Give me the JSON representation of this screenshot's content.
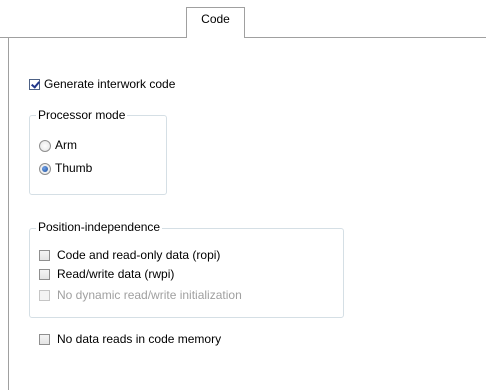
{
  "tabs": [
    {
      "label": "Code",
      "active": true
    }
  ],
  "generate_interwork": {
    "label": "Generate interwork code",
    "checked": true
  },
  "processor_mode": {
    "title": "Processor mode",
    "options": [
      {
        "label": "Arm",
        "selected": false
      },
      {
        "label": "Thumb",
        "selected": true
      }
    ]
  },
  "position_independence": {
    "title": "Position-independence",
    "options": [
      {
        "label": "Code and read-only data (ropi)",
        "checked": false,
        "enabled": true
      },
      {
        "label": "Read/write data (rwpi)",
        "checked": false,
        "enabled": true
      },
      {
        "label": "No dynamic read/write initialization",
        "checked": false,
        "enabled": false
      }
    ]
  },
  "no_data_reads": {
    "label": "No data reads in code memory",
    "checked": false
  },
  "colors": {
    "border": "#a0a0a0",
    "group_border": "#d5dfe5",
    "disabled_text": "#a0a0a0"
  }
}
